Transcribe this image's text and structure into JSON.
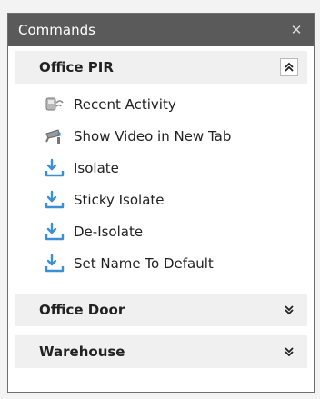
{
  "panel": {
    "title": "Commands"
  },
  "sections": [
    {
      "label": "Office PIR",
      "expanded": true,
      "items": [
        {
          "label": "Recent Activity",
          "icon": "activity-icon"
        },
        {
          "label": "Show Video in New Tab",
          "icon": "camera-icon"
        },
        {
          "label": "Isolate",
          "icon": "isolate-icon"
        },
        {
          "label": "Sticky Isolate",
          "icon": "isolate-icon"
        },
        {
          "label": "De-Isolate",
          "icon": "isolate-icon"
        },
        {
          "label": "Set Name To Default",
          "icon": "isolate-icon"
        }
      ]
    },
    {
      "label": "Office Door",
      "expanded": false
    },
    {
      "label": "Warehouse",
      "expanded": false
    }
  ],
  "colors": {
    "titlebar": "#5a5a5a",
    "section_header": "#f0f0f0",
    "icon_blue": "#3a8fd6"
  }
}
